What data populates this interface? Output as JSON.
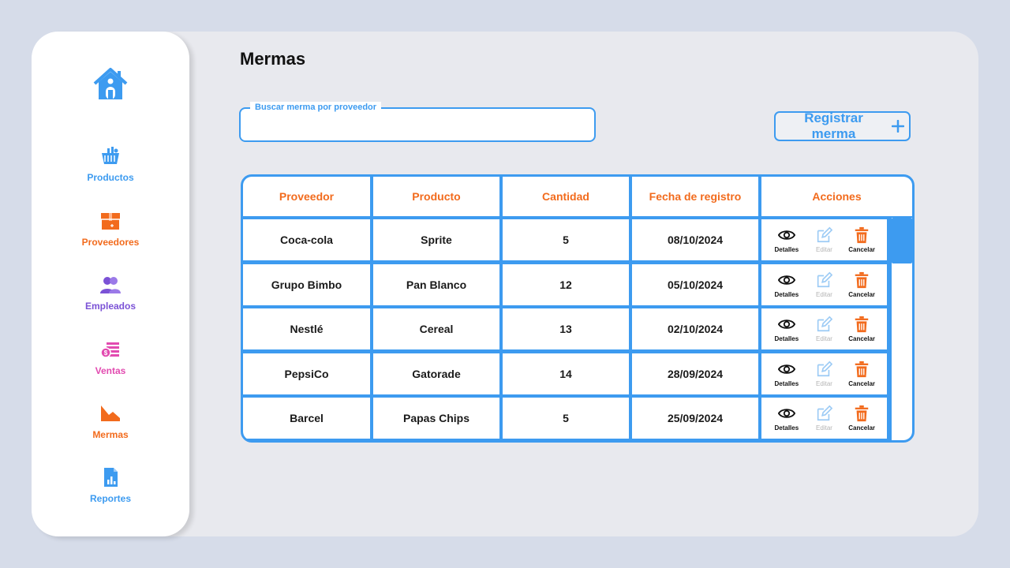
{
  "colors": {
    "accent": "#3d9bf0",
    "orange": "#f26b1d",
    "purple": "#7b52d6",
    "pink": "#e24bb0"
  },
  "sidebar": {
    "home_icon": "home-icon",
    "items": [
      {
        "label": "Productos",
        "icon": "basket-icon",
        "color": "#3d9bf0"
      },
      {
        "label": "Proveedores",
        "icon": "box-icon",
        "color": "#f26b1d"
      },
      {
        "label": "Empleados",
        "icon": "users-icon",
        "color": "#7b52d6"
      },
      {
        "label": "Ventas",
        "icon": "money-icon",
        "color": "#e24bb0"
      },
      {
        "label": "Mermas",
        "icon": "chart-down-icon",
        "color": "#f26b1d"
      },
      {
        "label": "Reportes",
        "icon": "report-icon",
        "color": "#3d9bf0"
      }
    ]
  },
  "page": {
    "title": "Mermas"
  },
  "search": {
    "label": "Buscar merma por proveedor",
    "value": "",
    "placeholder": ""
  },
  "register_button": {
    "label": "Registrar merma",
    "icon": "plus-icon"
  },
  "table": {
    "headers": [
      "Proveedor",
      "Producto",
      "Cantidad",
      "Fecha de registro",
      "Acciones"
    ],
    "actions": {
      "details": "Detalles",
      "edit": "Editar",
      "cancel": "Cancelar"
    },
    "rows": [
      {
        "proveedor": "Coca-cola",
        "producto": "Sprite",
        "cantidad": "5",
        "fecha": "08/10/2024"
      },
      {
        "proveedor": "Grupo Bimbo",
        "producto": "Pan Blanco",
        "cantidad": "12",
        "fecha": "05/10/2024"
      },
      {
        "proveedor": "Nestlé",
        "producto": "Cereal",
        "cantidad": "13",
        "fecha": "02/10/2024"
      },
      {
        "proveedor": "PepsiCo",
        "producto": "Gatorade",
        "cantidad": "14",
        "fecha": "28/09/2024"
      },
      {
        "proveedor": "Barcel",
        "producto": "Papas Chips",
        "cantidad": "5",
        "fecha": "25/09/2024"
      }
    ]
  }
}
